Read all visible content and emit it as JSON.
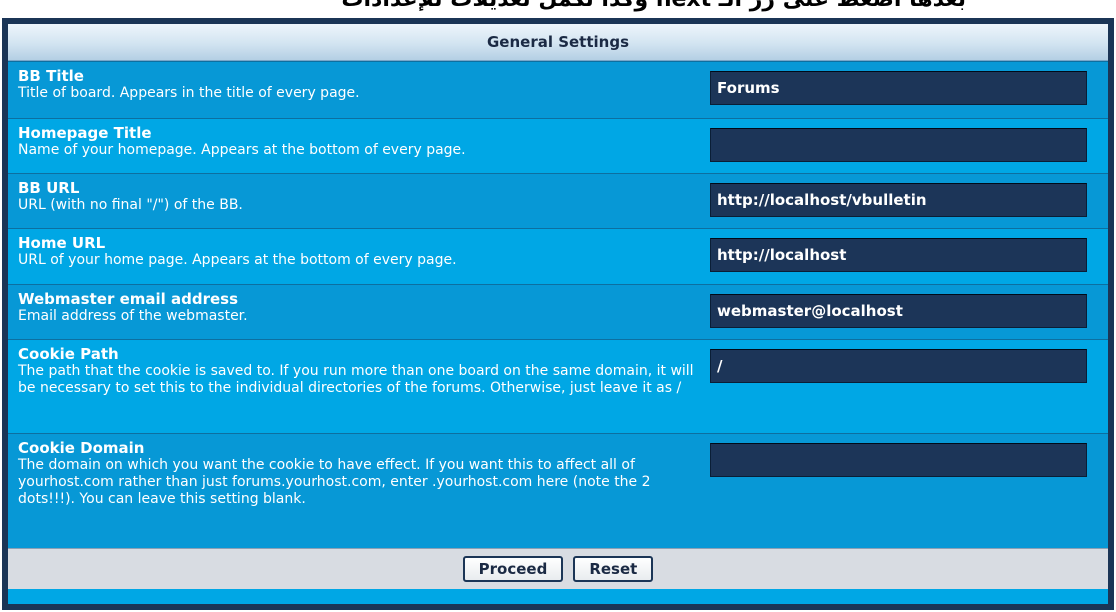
{
  "caption": "بعدها اضغط على زر الـ next وكذا تكمل تعديلات للإعدادات",
  "panel": {
    "title": "General Settings"
  },
  "settings": [
    {
      "title": "BB Title",
      "desc": "Title of board. Appears in the title of every page.",
      "value": "Forums"
    },
    {
      "title": "Homepage Title",
      "desc": "Name of your homepage. Appears at the bottom of every page.",
      "value": ""
    },
    {
      "title": "BB URL",
      "desc": "URL (with no final \"/\") of the BB.",
      "value": "http://localhost/vbulletin"
    },
    {
      "title": "Home URL",
      "desc": "URL of your home page. Appears at the bottom of every page.",
      "value": "http://localhost"
    },
    {
      "title": "Webmaster email address",
      "desc": "Email address of the webmaster.",
      "value": "webmaster@localhost"
    },
    {
      "title": "Cookie Path",
      "desc": "The path that the cookie is saved to. If you run more than one board on the same domain, it will be necessary to set this to the individual directories of the forums. Otherwise, just leave it as /",
      "value": "/"
    },
    {
      "title": "Cookie Domain",
      "desc": "The domain on which you want the cookie to have effect. If you want this to affect all of yourhost.com rather than just forums.yourhost.com, enter .yourhost.com here (note the 2 dots!!!). You can leave this setting blank.",
      "value": ""
    }
  ],
  "buttons": {
    "proceed": "Proceed",
    "reset": "Reset"
  },
  "colors": {
    "row_a": "#0798d6",
    "row_b": "#00a7e5",
    "field_bg": "#1c3558",
    "border": "#1b3556"
  }
}
